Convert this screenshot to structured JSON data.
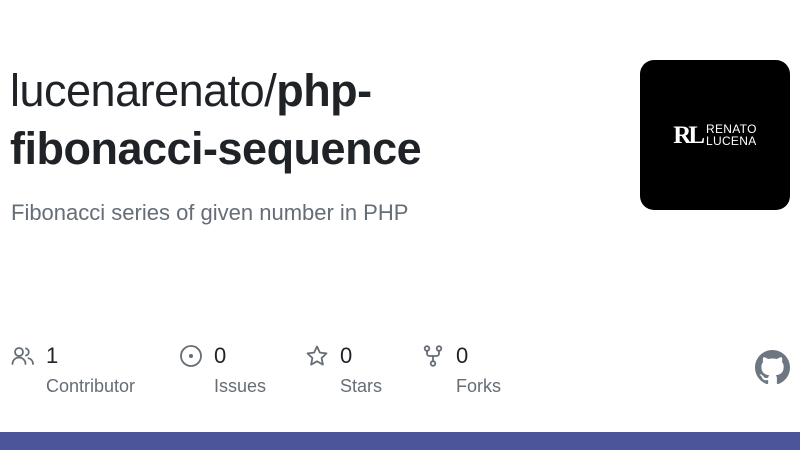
{
  "repo": {
    "owner": "lucenarenato/",
    "name_part1": "php-",
    "name_part2": "fibonacci-sequence",
    "description": "Fibonacci series of given number in PHP"
  },
  "avatar": {
    "logo_mark": "RL",
    "logo_line1": "RENATO",
    "logo_line2": "LUCENA"
  },
  "stats": [
    {
      "icon": "people-icon",
      "count": "1",
      "label": "Contributor"
    },
    {
      "icon": "issue-circle-icon",
      "count": "0",
      "label": "Issues"
    },
    {
      "icon": "star-icon",
      "count": "0",
      "label": "Stars"
    },
    {
      "icon": "fork-icon",
      "count": "0",
      "label": "Forks"
    }
  ],
  "colors": {
    "bar": "#4c559a",
    "icon": "#656d76",
    "github_mark": "#6e7781"
  }
}
